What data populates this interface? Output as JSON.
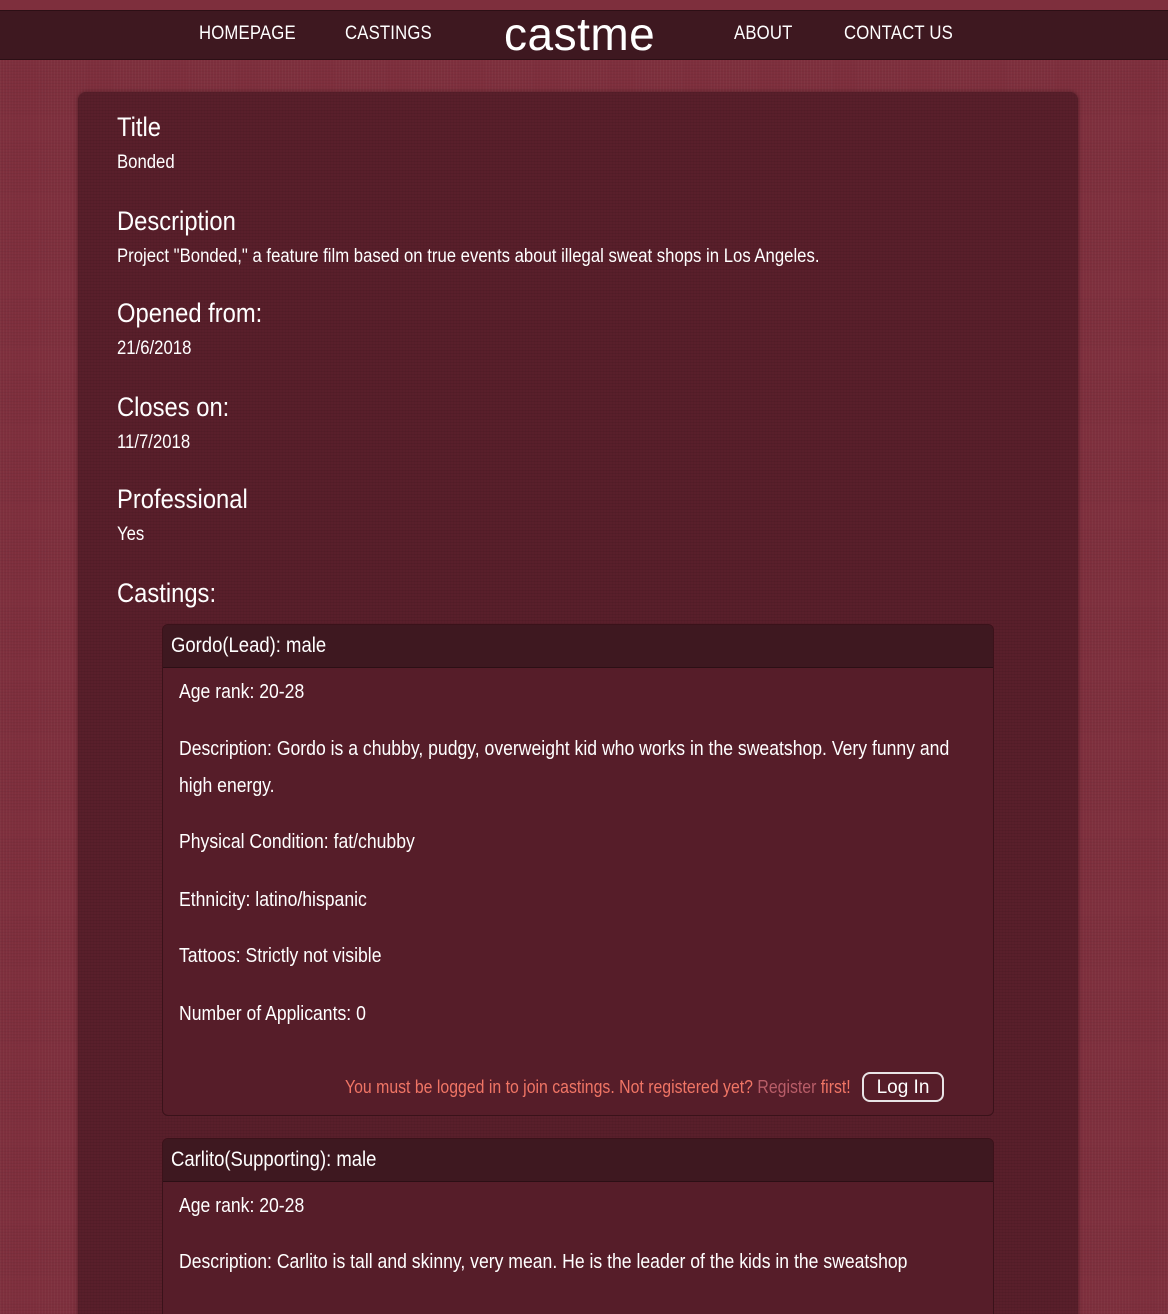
{
  "nav": {
    "homepage": "HOMEPAGE",
    "castings": "CASTINGS",
    "logo": "castme",
    "about": "ABOUT",
    "contact": "CONTACT US"
  },
  "project": {
    "title_label": "Title",
    "title_value": "Bonded",
    "description_label": "Description",
    "description_value": "Project \"Bonded,\" a feature film based on true events about illegal sweat shops in Los Angeles.",
    "opened_label": "Opened from:",
    "opened_value": "21/6/2018",
    "closes_label": "Closes on:",
    "closes_value": "11/7/2018",
    "professional_label": "Professional",
    "professional_value": "Yes",
    "castings_label": "Castings:"
  },
  "castings": [
    {
      "header": "Gordo(Lead): male",
      "age": "Age rank: 20-28",
      "description": "Description: Gordo is a chubby, pudgy, overweight kid who works in the sweatshop. Very funny and high energy.",
      "physical": "Physical Condition: fat/chubby",
      "ethnicity": "Ethnicity: latino/hispanic",
      "tattoos": "Tattoos: Strictly not visible",
      "applicants": "Number of Applicants: 0",
      "login_msg_pre": "You must be logged in to join castings. Not registered yet? ",
      "register_link": "Register",
      "login_msg_post": " first!",
      "login_button": "Log In"
    },
    {
      "header": "Carlito(Supporting): male",
      "age": "Age rank: 20-28",
      "description": "Description: Carlito is tall and skinny, very mean. He is the leader of the kids in the sweatshop"
    }
  ]
}
